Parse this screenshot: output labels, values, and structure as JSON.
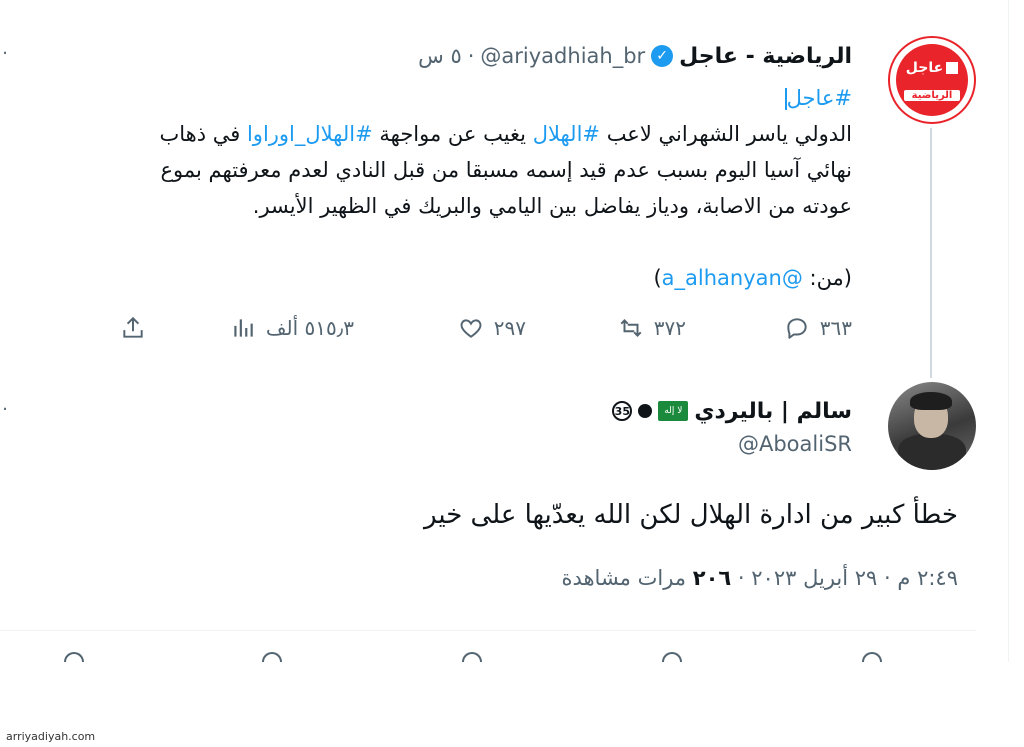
{
  "tweet": {
    "author_name": "الرياضية - عاجل",
    "handle": "@ariyadhiah_br",
    "separator": "·",
    "time": "٥ س",
    "avatar_line1": "عاجل",
    "avatar_line2": "الرياضية",
    "line1_hashtag": "#عاجل",
    "line2_a": "الدولي ياسر الشهراني لاعب ",
    "line2_tag1": "#الهلال",
    "line2_b": " يغيب عن  مواجهة ",
    "line2_tag2": "#الهلال_اوراوا",
    "line2_c": " في ذهاب",
    "line3": "نهائي آسيا اليوم بسبب عدم قيد إسمه مسبقا من قبل النادي لعدم معرفتهم بموع",
    "line4": "عودته من الاصابة، ودياز يفاضل بين اليامي والبريك في الظهير الأيسر.",
    "source_label": "(من: ",
    "source_handle": "@a_alhanyan",
    "source_close": ")",
    "replies": "٣٦٣",
    "retweets": "٣٧٢",
    "likes": "٢٩٧",
    "views": "٥١٥٫٣ ألف"
  },
  "reply": {
    "author_name": "سالم | باليردي",
    "flag_text": "لا إله",
    "circled_badge": "35",
    "handle": "@AboaliSR",
    "text": "خطأ كبير من ادارة الهلال لكن الله يعدّيها على خير",
    "time": "٢:٤٩ م",
    "date": "٢٩ أبريل ٢٠٢٣",
    "views_count": "٢٠٦",
    "views_label": "مرات مشاهدة",
    "dot": "·"
  },
  "watermark": "arriyadiyah.com",
  "colors": {
    "accent": "#1d9bf0",
    "text": "#0f1419",
    "muted": "#536471",
    "brand_red": "#e9242a"
  },
  "icons": [
    "reply-icon",
    "retweet-icon",
    "like-icon",
    "views-icon",
    "share-icon",
    "verified-icon",
    "more-icon"
  ]
}
